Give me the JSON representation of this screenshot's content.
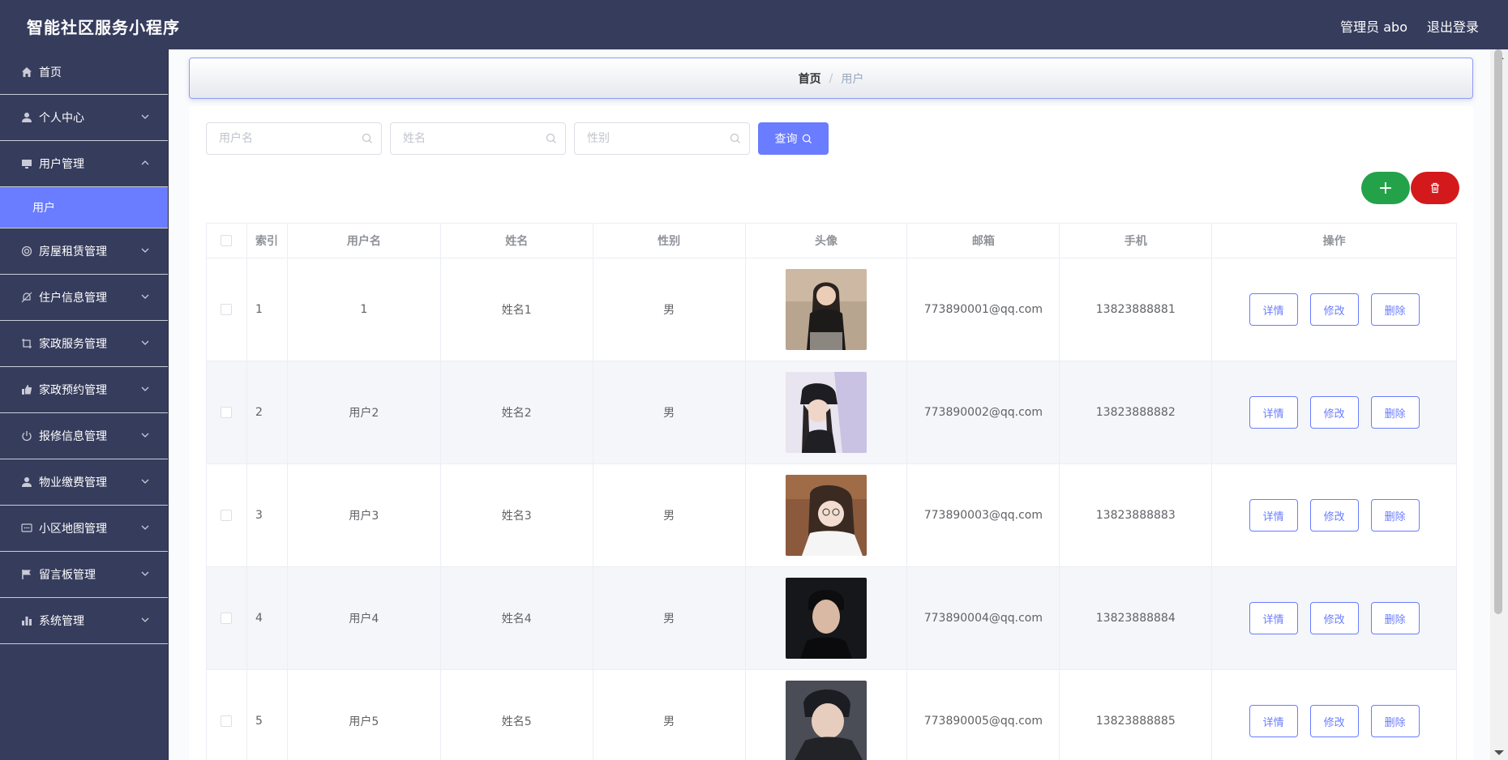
{
  "header": {
    "app_title": "智能社区服务小程序",
    "admin_label": "管理员 abo",
    "logout_label": "退出登录"
  },
  "sidebar": {
    "items": [
      {
        "label": "首页",
        "icon": "home-icon",
        "has_chevron": false
      },
      {
        "label": "个人中心",
        "icon": "user-icon",
        "has_chevron": true
      },
      {
        "label": "用户管理",
        "icon": "monitor-icon",
        "has_chevron": true,
        "expanded": true
      },
      {
        "label": "房屋租赁管理",
        "icon": "target-icon",
        "has_chevron": true
      },
      {
        "label": "住户信息管理",
        "icon": "bell-off-icon",
        "has_chevron": true
      },
      {
        "label": "家政服务管理",
        "icon": "crop-icon",
        "has_chevron": true
      },
      {
        "label": "家政预约管理",
        "icon": "thumb-icon",
        "has_chevron": true
      },
      {
        "label": "报修信息管理",
        "icon": "power-icon",
        "has_chevron": true
      },
      {
        "label": "物业缴费管理",
        "icon": "user-icon",
        "has_chevron": true
      },
      {
        "label": "小区地图管理",
        "icon": "chat-icon",
        "has_chevron": true
      },
      {
        "label": "留言板管理",
        "icon": "flag-icon",
        "has_chevron": true
      },
      {
        "label": "系统管理",
        "icon": "bar-chart-icon",
        "has_chevron": true
      }
    ],
    "sub_item": "用户"
  },
  "breadcrumb": {
    "home": "首页",
    "separator": "/",
    "current": "用户"
  },
  "search": {
    "username_placeholder": "用户名",
    "name_placeholder": "姓名",
    "gender_placeholder": "性别",
    "query_label": "查询"
  },
  "actions": {
    "add_label": "+"
  },
  "table": {
    "headers": {
      "index": "索引",
      "username": "用户名",
      "name": "姓名",
      "gender": "性别",
      "avatar": "头像",
      "email": "邮箱",
      "phone": "手机",
      "ops": "操作"
    },
    "ops_labels": {
      "detail": "详情",
      "edit": "修改",
      "delete": "删除"
    },
    "rows": [
      {
        "index": "1",
        "username": "1",
        "name": "姓名1",
        "gender": "男",
        "email": "773890001@qq.com",
        "phone": "13823888881"
      },
      {
        "index": "2",
        "username": "用户2",
        "name": "姓名2",
        "gender": "男",
        "email": "773890002@qq.com",
        "phone": "13823888882"
      },
      {
        "index": "3",
        "username": "用户3",
        "name": "姓名3",
        "gender": "男",
        "email": "773890003@qq.com",
        "phone": "13823888883"
      },
      {
        "index": "4",
        "username": "用户4",
        "name": "姓名4",
        "gender": "男",
        "email": "773890004@qq.com",
        "phone": "13823888884"
      },
      {
        "index": "5",
        "username": "用户5",
        "name": "姓名5",
        "gender": "男",
        "email": "773890005@qq.com",
        "phone": "13823888885"
      }
    ]
  },
  "colors": {
    "header_bg": "#363c5c",
    "accent": "#6a7cff",
    "add_green": "#23a24a",
    "delete_red": "#d4191d"
  }
}
